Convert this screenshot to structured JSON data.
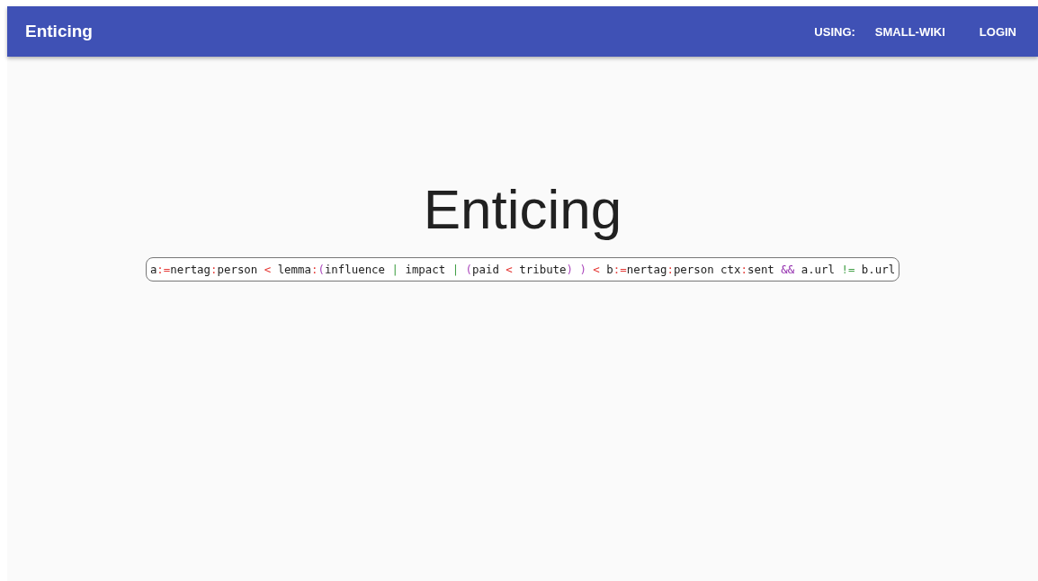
{
  "app_bar": {
    "title": "Enticing",
    "using_label": "USING:",
    "corpus": "SMALL-WIKI",
    "login": "LOGIN"
  },
  "heading": "Enticing",
  "query_field": {
    "tokens": [
      {
        "text": "a",
        "kind": "word"
      },
      {
        "text": ":=",
        "kind": "operator"
      },
      {
        "text": "nertag",
        "kind": "word"
      },
      {
        "text": ":",
        "kind": "operator"
      },
      {
        "text": "person ",
        "kind": "word"
      },
      {
        "text": "<",
        "kind": "operator"
      },
      {
        "text": " lemma",
        "kind": "word"
      },
      {
        "text": ":",
        "kind": "operator"
      },
      {
        "text": "(",
        "kind": "paren"
      },
      {
        "text": "influence ",
        "kind": "word"
      },
      {
        "text": "|",
        "kind": "alternative"
      },
      {
        "text": " impact ",
        "kind": "word"
      },
      {
        "text": "| ",
        "kind": "alternative"
      },
      {
        "text": "(",
        "kind": "paren"
      },
      {
        "text": "paid ",
        "kind": "word"
      },
      {
        "text": "<",
        "kind": "operator"
      },
      {
        "text": " tribute",
        "kind": "word"
      },
      {
        "text": ") ",
        "kind": "paren"
      },
      {
        "text": ") ",
        "kind": "paren"
      },
      {
        "text": "<",
        "kind": "operator"
      },
      {
        "text": " b",
        "kind": "word"
      },
      {
        "text": ":=",
        "kind": "operator"
      },
      {
        "text": "nertag",
        "kind": "word"
      },
      {
        "text": ":",
        "kind": "operator"
      },
      {
        "text": "person ctx",
        "kind": "word"
      },
      {
        "text": ":",
        "kind": "operator"
      },
      {
        "text": "sent ",
        "kind": "word"
      },
      {
        "text": "&&",
        "kind": "logic"
      },
      {
        "text": " a.url ",
        "kind": "word"
      },
      {
        "text": "!=",
        "kind": "alternative"
      },
      {
        "text": " b.url",
        "kind": "word"
      }
    ]
  }
}
